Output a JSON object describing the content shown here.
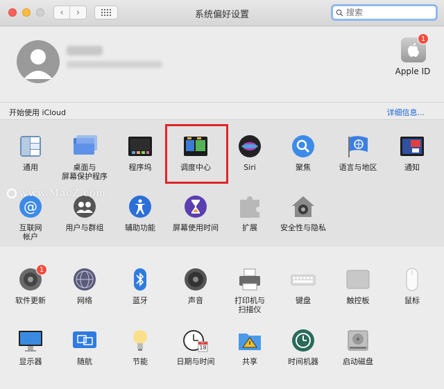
{
  "window": {
    "title": "系统偏好设置",
    "search_placeholder": "搜索"
  },
  "account": {
    "apple_id_label": "Apple ID",
    "apple_id_badge": "1",
    "icloud_prompt": "开始使用 iCloud",
    "details_link": "详细信息..."
  },
  "prefs_top": [
    {
      "label": "通用"
    },
    {
      "label": "桌面与\n屏幕保护程序"
    },
    {
      "label": "程序坞"
    },
    {
      "label": "调度中心"
    },
    {
      "label": "Siri"
    },
    {
      "label": "聚焦"
    },
    {
      "label": "语言与地区"
    },
    {
      "label": "通知"
    },
    {
      "label": "互联网\n帐户"
    },
    {
      "label": "用户与群组"
    },
    {
      "label": "辅助功能"
    },
    {
      "label": "屏幕使用时间"
    },
    {
      "label": "扩展"
    },
    {
      "label": "安全性与隐私"
    }
  ],
  "prefs_bottom": [
    {
      "label": "软件更新",
      "badge": "1"
    },
    {
      "label": "网络"
    },
    {
      "label": "蓝牙"
    },
    {
      "label": "声音"
    },
    {
      "label": "打印机与\n扫描仪"
    },
    {
      "label": "键盘"
    },
    {
      "label": "触控板"
    },
    {
      "label": "鼠标"
    },
    {
      "label": "显示器"
    },
    {
      "label": "随航"
    },
    {
      "label": "节能"
    },
    {
      "label": "日期与时间"
    },
    {
      "label": "共享"
    },
    {
      "label": "时间机器"
    },
    {
      "label": "启动磁盘"
    }
  ],
  "watermark": "www.MacZ.com",
  "date_icon": {
    "month": "JUL",
    "day": "18"
  },
  "colors": {
    "highlight": "#e0242a",
    "link": "#1a62d6",
    "badge": "#f24c3d"
  }
}
